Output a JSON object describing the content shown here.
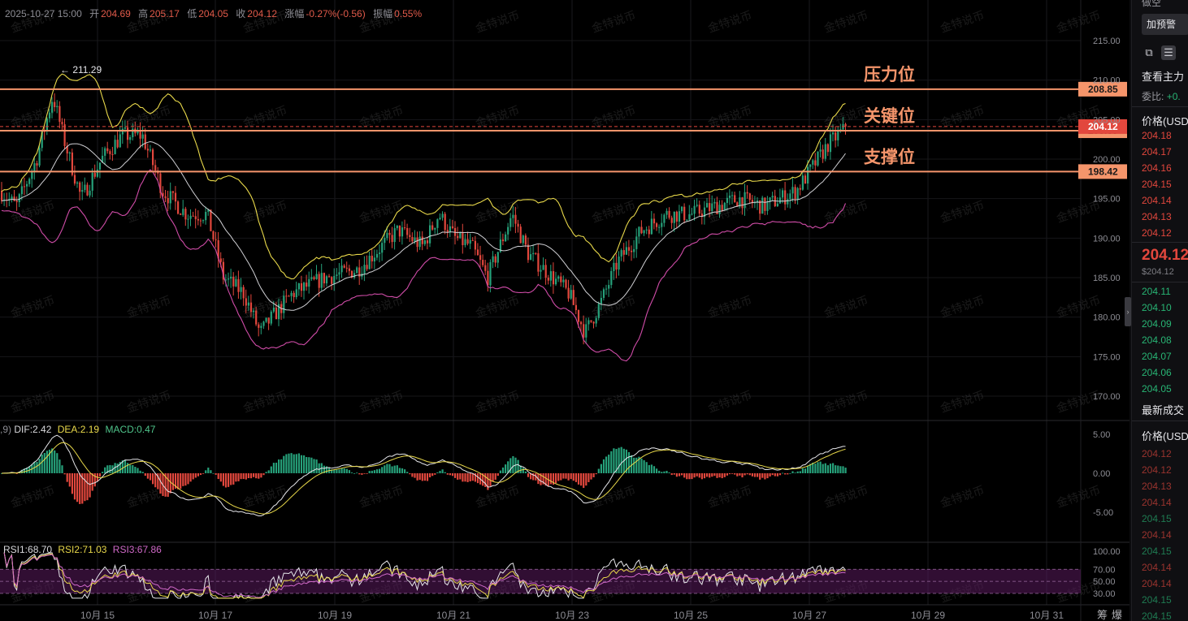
{
  "header": {
    "datetime": "2025-10-27 15:00",
    "open_label": "开",
    "open": "204.69",
    "high_label": "高",
    "high": "205.17",
    "low_label": "低",
    "low": "204.05",
    "close_label": "收",
    "close": "204.12",
    "change_label": "涨幅",
    "change": "-0.27%(-0.56)",
    "amplitude_label": "振幅",
    "amplitude": "0.55%"
  },
  "watermark": "金特说币",
  "price_axis": {
    "ticks": [
      "215.00",
      "210.00",
      "205.00",
      "200.00",
      "195.00",
      "190.00",
      "185.00",
      "180.00",
      "175.00",
      "170.00"
    ],
    "tick_values": [
      215,
      210,
      205,
      200,
      195,
      190,
      185,
      180,
      175,
      170
    ]
  },
  "levels": [
    {
      "name": "压力位",
      "value": 208.85,
      "label": "208.85"
    },
    {
      "name": "关键位",
      "value": 203.59,
      "label": "203.59"
    },
    {
      "name": "支撑位",
      "value": 198.42,
      "label": "198.42"
    }
  ],
  "current_price": {
    "value": 204.12,
    "label": "204.12"
  },
  "peak_marker": {
    "value": 211.29,
    "label": "← 211.29"
  },
  "x_axis": {
    "labels": [
      "10月 15",
      "10月 17",
      "10月 19",
      "10月 21",
      "10月 23",
      "10月 25",
      "10月 27",
      "10月 29",
      "10月 31"
    ]
  },
  "bottom_tabs": [
    "筹",
    "爆"
  ],
  "macd": {
    "params": ",9)",
    "dif_label": "DIF:",
    "dif": "2.42",
    "dea_label": "DEA:",
    "dea": "2.19",
    "macd_label": "MACD:",
    "macd": "0.47",
    "ticks": [
      "5.00",
      "0.00",
      "-5.00"
    ],
    "tick_values": [
      5,
      0,
      -5
    ]
  },
  "rsi": {
    "rsi1_label": "RSI1:",
    "rsi1": "68.70",
    "rsi2_label": "RSI2:",
    "rsi2": "71.03",
    "rsi3_label": "RSI3:",
    "rsi3": "67.86",
    "ticks": [
      "100.00",
      "70.00",
      "50.00",
      "30.00"
    ],
    "tick_values": [
      100,
      70,
      50,
      30
    ]
  },
  "sidebar": {
    "top_cut_left": "做空",
    "alert_button": "加预警",
    "main_force_text": "查看主力",
    "ratio_label": "委比:",
    "ratio_value": "+0.",
    "price_header": "价格(USD",
    "asks": [
      "204.18",
      "204.17",
      "204.16",
      "204.15",
      "204.14",
      "204.13",
      "204.12"
    ],
    "last_price": "204.12",
    "last_price_usd": "$204.12",
    "bids": [
      "204.11",
      "204.10",
      "204.09",
      "204.08",
      "204.07",
      "204.06",
      "204.05"
    ],
    "trades_title": "最新成交",
    "trades_price_header": "价格(USD",
    "trades": [
      {
        "p": "204.12",
        "side": "sell"
      },
      {
        "p": "204.12",
        "side": "sell"
      },
      {
        "p": "204.13",
        "side": "sell"
      },
      {
        "p": "204.14",
        "side": "sell"
      },
      {
        "p": "204.15",
        "side": "buy"
      },
      {
        "p": "204.14",
        "side": "sell"
      },
      {
        "p": "204.15",
        "side": "buy"
      },
      {
        "p": "204.14",
        "side": "sell"
      },
      {
        "p": "204.14",
        "side": "sell"
      },
      {
        "p": "204.15",
        "side": "buy"
      },
      {
        "p": "204.15",
        "side": "buy"
      }
    ]
  },
  "colors": {
    "up": "#26a17a",
    "down": "#e2473d",
    "level": "#f5956b",
    "level_label": "#f5956b",
    "boll_upper": "#e8d84a",
    "boll_mid": "#d0d0d4",
    "boll_lower": "#d04ca8",
    "price_tag": "#e2473d",
    "rsi_band": "#5a1a5c"
  }
}
